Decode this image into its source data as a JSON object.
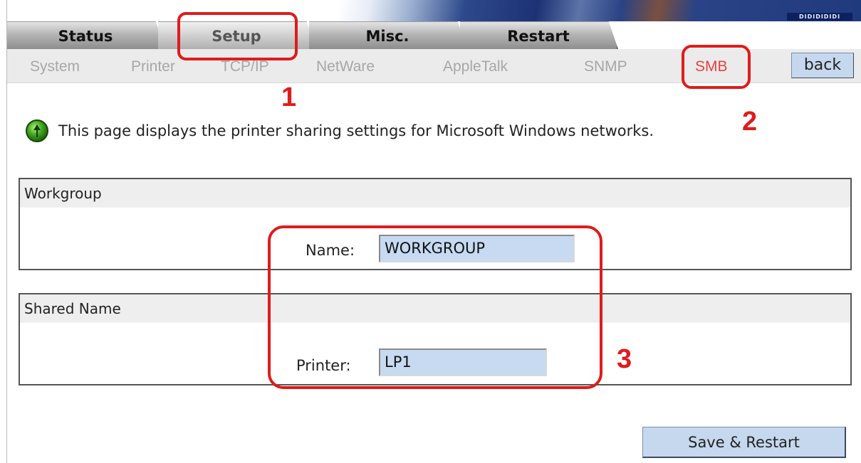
{
  "banner": {
    "stripe_text": "DIDIDIDIDI"
  },
  "tabs": [
    {
      "label": "Status"
    },
    {
      "label": "Setup"
    },
    {
      "label": "Misc."
    },
    {
      "label": "Restart"
    }
  ],
  "subnav": {
    "items": [
      {
        "label": "System"
      },
      {
        "label": "Printer"
      },
      {
        "label": "TCP/IP"
      },
      {
        "label": "NetWare"
      },
      {
        "label": "AppleTalk"
      },
      {
        "label": "SNMP"
      },
      {
        "label": "SMB"
      }
    ],
    "back_label": "back",
    "active_item": "SMB"
  },
  "info": {
    "text": "This page displays the printer sharing settings for Microsoft Windows networks."
  },
  "workgroup": {
    "heading": "Workgroup",
    "name_label": "Name:",
    "name_value": "WORKGROUP"
  },
  "shared": {
    "heading": "Shared Name",
    "printer_label": "Printer:",
    "printer_value": "LP1"
  },
  "save_label": "Save & Restart",
  "annotations": {
    "n1": "1",
    "n2": "2",
    "n3": "3"
  },
  "colors": {
    "annotation": "#e01b1b",
    "active_subnav": "#e8413f",
    "button_fill": "#c6d8ee"
  }
}
